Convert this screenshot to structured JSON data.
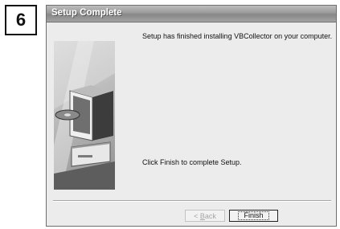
{
  "step_badge": "6",
  "window": {
    "title": "Setup Complete"
  },
  "messages": {
    "installed": "Setup has finished installing VBCollector on your computer.",
    "instruction": "Click Finish to complete Setup."
  },
  "buttons": {
    "back_mnemonic": "B",
    "back_rest": "ack",
    "back_prefix": "< ",
    "finish_label": "Finish"
  },
  "illustration": {
    "icon": "computer-monitor-with-cd-icon"
  },
  "colors": {
    "titlebar": "#9a9a9a",
    "dialog_background": "#ececec",
    "disabled_text": "#a5a5a5"
  }
}
